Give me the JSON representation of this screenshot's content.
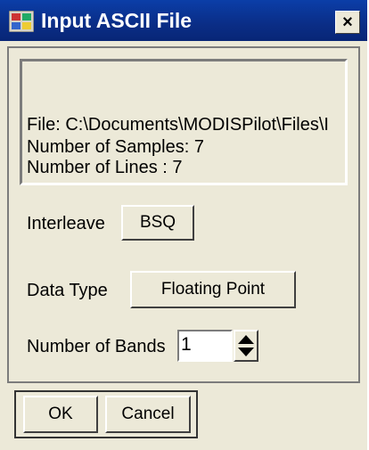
{
  "window": {
    "title": "Input ASCII File",
    "close_label": "×"
  },
  "info": {
    "file_line": "File: C:\\Documents\\MODISPilot\\Files\\I",
    "samples_line": "Number of Samples: 7",
    "lines_line": "Number of Lines  : 7"
  },
  "interleave": {
    "label": "Interleave",
    "value": "BSQ"
  },
  "data_type": {
    "label": "Data Type",
    "value": "Floating Point"
  },
  "bands": {
    "label": "Number of Bands",
    "value": "1"
  },
  "buttons": {
    "ok": "OK",
    "cancel": "Cancel"
  },
  "colors": {
    "title_bar": "#0a2d86",
    "dialog_bg": "#ece9d8"
  }
}
